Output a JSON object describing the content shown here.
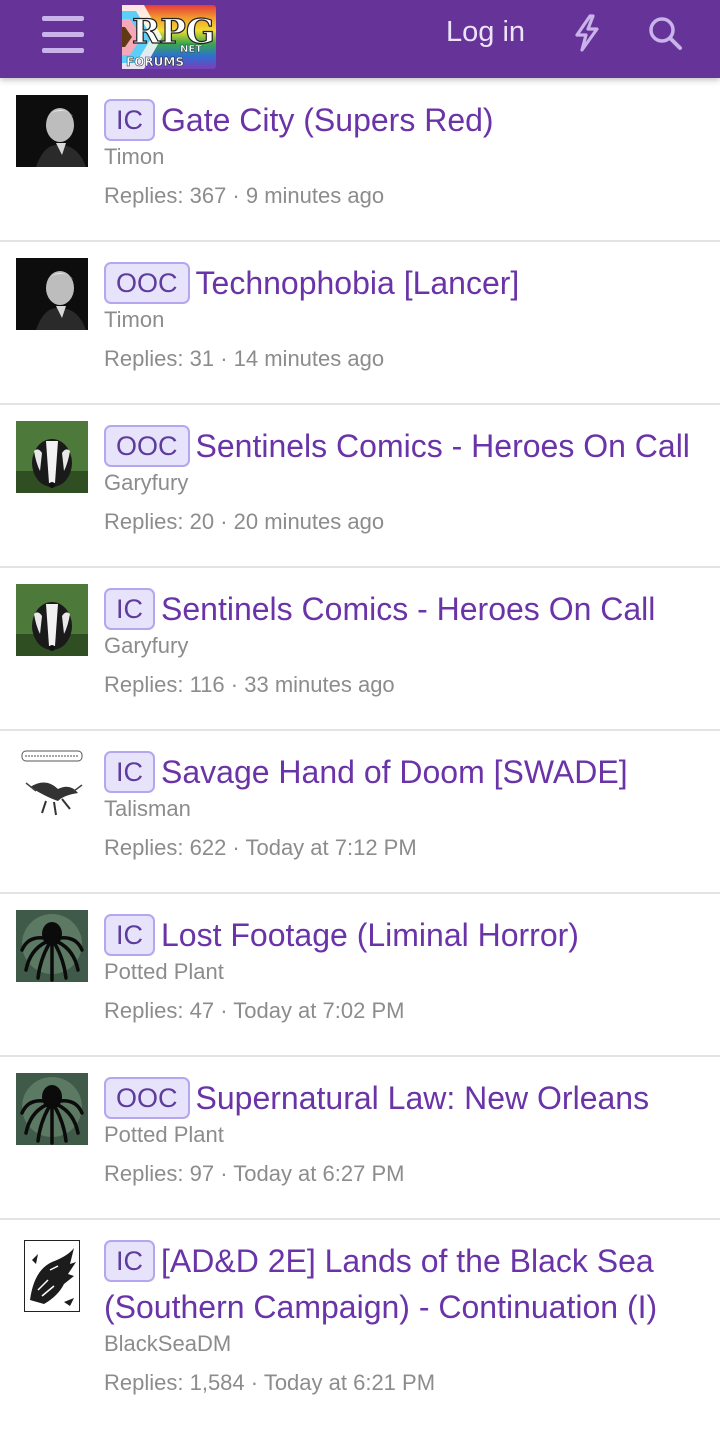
{
  "header": {
    "logo_text_main": "RPG",
    "logo_text_net": "NET",
    "logo_text_forums": "FORUMS",
    "login_label": "Log in",
    "colors": {
      "bar": "#663399",
      "icon": "#c9b3ea"
    },
    "icons": [
      "menu-icon",
      "bolt-icon",
      "search-icon"
    ]
  },
  "threads": [
    {
      "prefix": "IC",
      "title": "Gate City (Supers Red)",
      "author": "Timon",
      "replies": "Replies: 367",
      "time": "9 minutes ago",
      "avatar": "man-portrait"
    },
    {
      "prefix": "OOC",
      "title": "Technophobia [Lancer]",
      "author": "Timon",
      "replies": "Replies: 31",
      "time": "14 minutes ago",
      "avatar": "man-portrait"
    },
    {
      "prefix": "OOC",
      "title": "Sentinels Comics - Heroes On Call",
      "author": "Garyfury",
      "replies": "Replies: 20",
      "time": "20 minutes ago",
      "avatar": "badger"
    },
    {
      "prefix": "IC",
      "title": "Sentinels Comics - Heroes On Call",
      "author": "Garyfury",
      "replies": "Replies: 116",
      "time": "33 minutes ago",
      "avatar": "badger"
    },
    {
      "prefix": "IC",
      "title": "Savage Hand of Doom [SWADE]",
      "author": "Talisman",
      "replies": "Replies: 622",
      "time": "Today at 7:12 PM",
      "avatar": "sketch-bird"
    },
    {
      "prefix": "IC",
      "title": "Lost Footage (Liminal Horror)",
      "author": "Potted Plant",
      "replies": "Replies: 47",
      "time": "Today at 7:02 PM",
      "avatar": "octopus"
    },
    {
      "prefix": "OOC",
      "title": "Supernatural Law: New Orleans",
      "author": "Potted Plant",
      "replies": "Replies: 97",
      "time": "Today at 6:27 PM",
      "avatar": "octopus"
    },
    {
      "prefix": "IC",
      "title": "[AD&D 2E] Lands of the Black Sea (Southern Campaign) - Continuation (I)",
      "author": "BlackSeaDM",
      "replies": "Replies: 1,584",
      "time": "Today at 6:21 PM",
      "avatar": "dragon-sketch"
    }
  ]
}
